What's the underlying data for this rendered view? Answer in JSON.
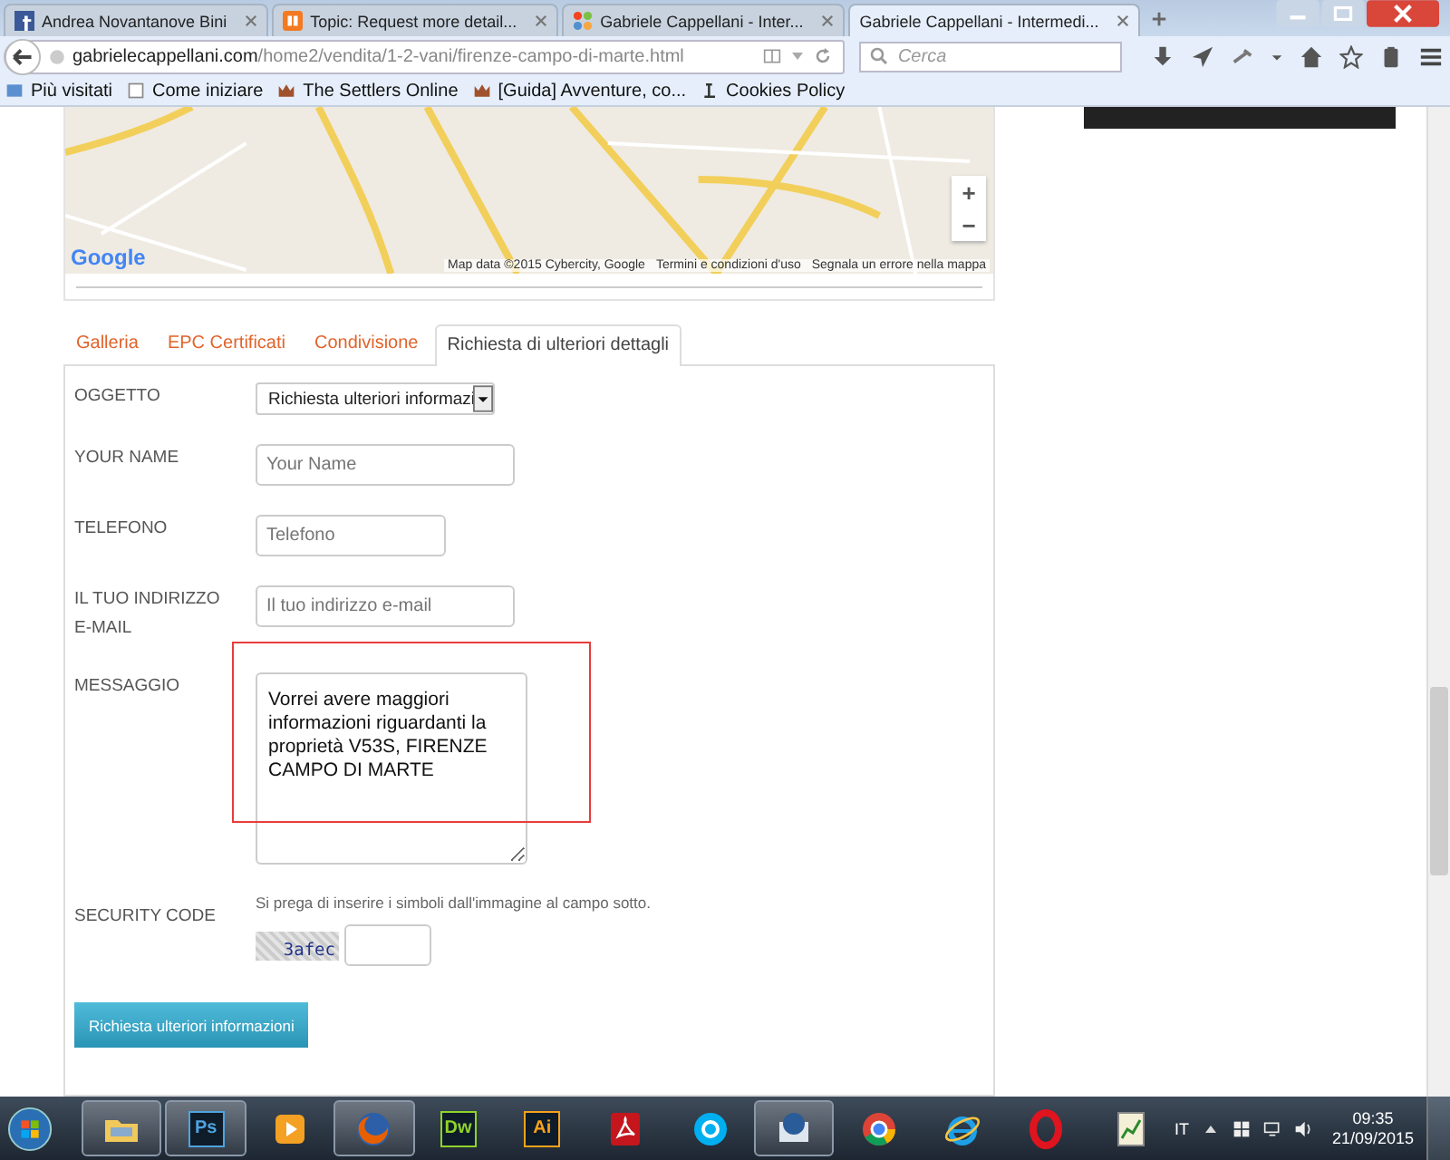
{
  "browser": {
    "tabs": [
      {
        "kind": "facebook",
        "title": "Andrea Novantanove Bini",
        "selected": false
      },
      {
        "kind": "forum",
        "title": "Topic: Request more detail...",
        "selected": false
      },
      {
        "kind": "cms",
        "title": "Gabriele Cappellani - Inter...",
        "selected": false
      },
      {
        "kind": "none",
        "title": "Gabriele Cappellani - Intermedi...",
        "selected": true
      }
    ],
    "url": {
      "host": "gabrielecappellani.com",
      "path": "/home2/vendita/1-2-vani/firenze-campo-di-marte.html"
    },
    "search": {
      "placeholder": "Cerca"
    },
    "bookmarks": [
      {
        "kind": "folder",
        "label": "Più visitati"
      },
      {
        "kind": "page",
        "label": "Come iniziare"
      },
      {
        "kind": "crown",
        "label": "The Settlers Online"
      },
      {
        "kind": "crown",
        "label": "[Guida] Avventure, co..."
      },
      {
        "kind": "cookie",
        "label": "Cookies Policy"
      }
    ]
  },
  "map": {
    "logo": "Google",
    "attribution": "Map data ©2015 Cybercity, Google",
    "links": [
      "Termini e condizioni d'uso",
      "Segnala un errore nella mappa"
    ],
    "zoom": [
      "+",
      "−"
    ]
  },
  "content_tabs": [
    {
      "label": "Galleria",
      "selected": false
    },
    {
      "label": "EPC Certificati",
      "selected": false
    },
    {
      "label": "Condivisione",
      "selected": false
    },
    {
      "label": "Richiesta di ulteriori dettagli",
      "selected": true
    }
  ],
  "form": {
    "fields": [
      {
        "kind": "select",
        "label": "OGGETTO",
        "value": "Richiesta ulteriori informazi",
        "highlighted": false
      },
      {
        "kind": "text",
        "label": "YOUR NAME",
        "placeholder": "Your Name",
        "highlighted": false
      },
      {
        "kind": "tel",
        "label": "TELEFONO",
        "placeholder": "Telefono",
        "highlighted": false
      },
      {
        "kind": "email",
        "label": "IL TUO INDIRIZZO E-MAIL",
        "placeholder": "Il tuo indirizzo e-mail",
        "highlighted": false
      },
      {
        "kind": "textarea",
        "label": "MESSAGGIO",
        "value": "Vorrei avere maggiori informazioni riguardanti la proprietà V53S, FIRENZE CAMPO DI MARTE",
        "highlighted": true
      },
      {
        "kind": "captcha",
        "label": "SECURITY CODE",
        "hint": "Si prega di inserire i simboli dall'immagine al campo sotto.",
        "captcha": "3afec",
        "highlighted": false
      }
    ],
    "submit": "Richiesta ulteriori informazioni"
  },
  "taskbar": {
    "apps": [
      {
        "kind": "folder",
        "running": true
      },
      {
        "kind": "tile",
        "label": "Ps",
        "color": "#4fa3e0",
        "running": true
      },
      {
        "kind": "media",
        "running": false
      },
      {
        "kind": "firefox",
        "running": true
      },
      {
        "kind": "tile",
        "label": "Dw",
        "color": "#8fd32a",
        "running": false
      },
      {
        "kind": "tile",
        "label": "Ai",
        "color": "#f7a21b",
        "running": false
      },
      {
        "kind": "pdf",
        "running": false
      },
      {
        "kind": "skype",
        "running": false
      },
      {
        "kind": "mail",
        "running": true
      },
      {
        "kind": "chrome",
        "running": false
      },
      {
        "kind": "ie",
        "running": false
      },
      {
        "kind": "opera",
        "running": false
      },
      {
        "kind": "chart",
        "running": false
      }
    ],
    "language": "IT",
    "time": "09:35",
    "date": "21/09/2015"
  }
}
